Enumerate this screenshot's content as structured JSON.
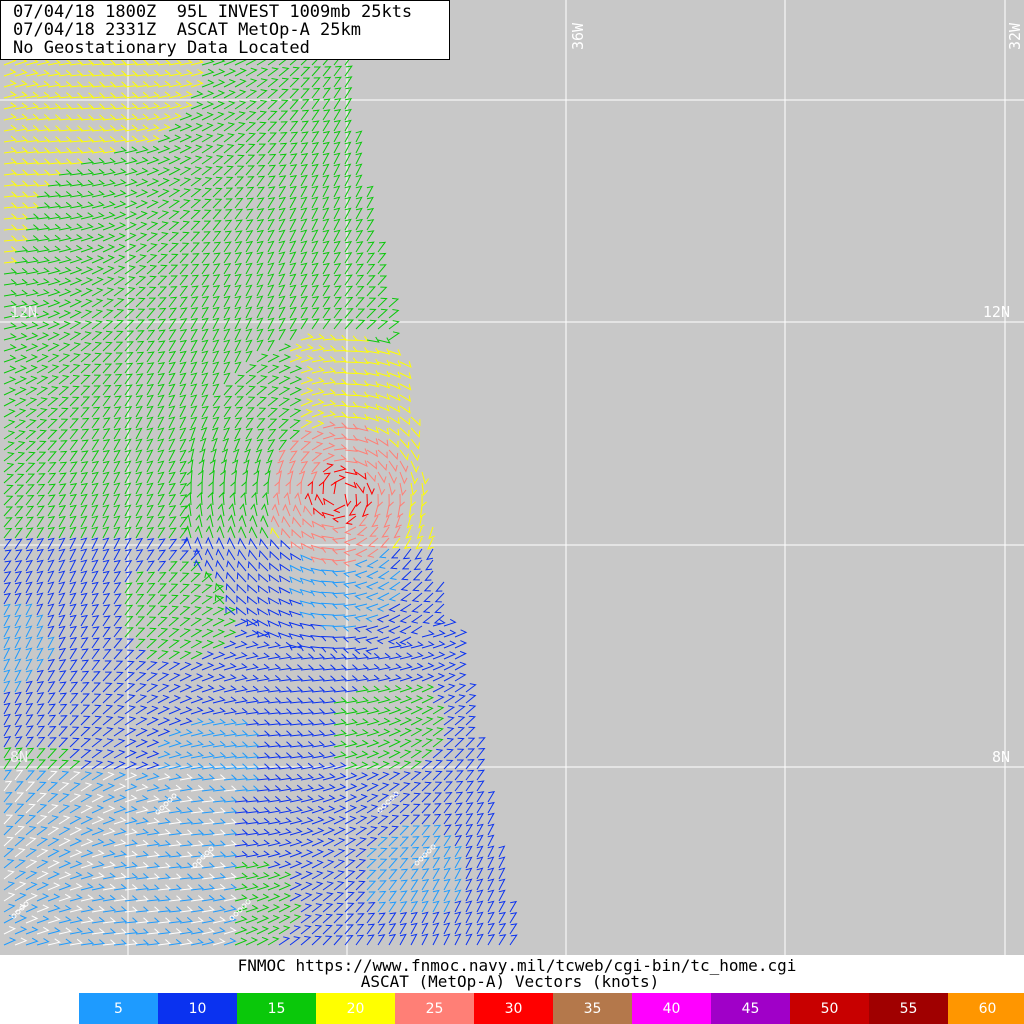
{
  "header": {
    "line1": "07/04/18 1800Z  95L INVEST 1009mb 25kts",
    "line2": "07/04/18 2331Z  ASCAT MetOp-A 25km",
    "line3": "No Geostationary Data Located"
  },
  "map": {
    "background_color": "#c8c8c8",
    "grid_color": "#ffffff",
    "lat_labels": [
      "12N",
      "12N",
      "8N",
      "8N"
    ],
    "lon_labels": [
      "36W",
      "32W"
    ]
  },
  "footer": {
    "source_url": "FNMOC https://www.fnmoc.navy.mil/tcweb/cgi-bin/tc_home.cgi",
    "product_title": "ASCAT (MetOp-A) Vectors (knots)"
  },
  "legend": [
    {
      "label": "5",
      "color": "#1e9bff"
    },
    {
      "label": "10",
      "color": "#0a32f0"
    },
    {
      "label": "15",
      "color": "#0ac80a"
    },
    {
      "label": "20",
      "color": "#ffff00"
    },
    {
      "label": "25",
      "color": "#ff7f76"
    },
    {
      "label": "30",
      "color": "#ff0000"
    },
    {
      "label": "35",
      "color": "#b4784b"
    },
    {
      "label": "40",
      "color": "#ff00ff"
    },
    {
      "label": "45",
      "color": "#a000c8"
    },
    {
      "label": "50",
      "color": "#c80000"
    },
    {
      "label": "55",
      "color": "#a00000"
    },
    {
      "label": "60",
      "color": "#ff9600"
    }
  ]
}
